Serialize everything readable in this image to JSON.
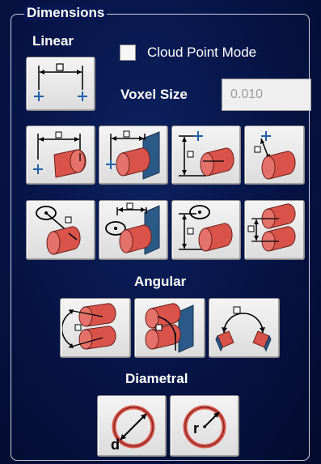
{
  "panel": {
    "title": "Dimensions"
  },
  "linear": {
    "label": "Linear",
    "cloud_point_mode": {
      "label": "Cloud Point Mode",
      "checked": false
    },
    "voxel_size": {
      "label": "Voxel Size",
      "value": "0.010"
    },
    "tools": [
      {
        "icon": "linear-point-to-point-icon"
      },
      {
        "icon": "linear-point-to-cylinder-icon"
      },
      {
        "icon": "linear-cylinder-to-plane-icon"
      },
      {
        "icon": "linear-vertical-point-to-cylinder-icon"
      },
      {
        "icon": "linear-point-to-axis-icon"
      },
      {
        "icon": "linear-circle-to-cylinder-icon"
      },
      {
        "icon": "linear-circle-to-plane-icon"
      },
      {
        "icon": "linear-vertical-circle-to-cylinder-icon"
      },
      {
        "icon": "linear-cylinder-to-cylinder-icon"
      }
    ]
  },
  "angular": {
    "label": "Angular",
    "tools": [
      {
        "icon": "angular-cylinder-to-cylinder-icon"
      },
      {
        "icon": "angular-cylinder-to-plane-icon"
      },
      {
        "icon": "angular-plane-to-plane-icon"
      }
    ]
  },
  "diametral": {
    "label": "Diametral",
    "tools": [
      {
        "icon": "diameter-icon",
        "letter": "d"
      },
      {
        "icon": "radius-icon",
        "letter": "r"
      }
    ]
  },
  "colors": {
    "background": "#061345",
    "cylinder_red": "#d9534a",
    "plane_blue": "#2b5a88",
    "marker_blue": "#1f5fa8"
  }
}
